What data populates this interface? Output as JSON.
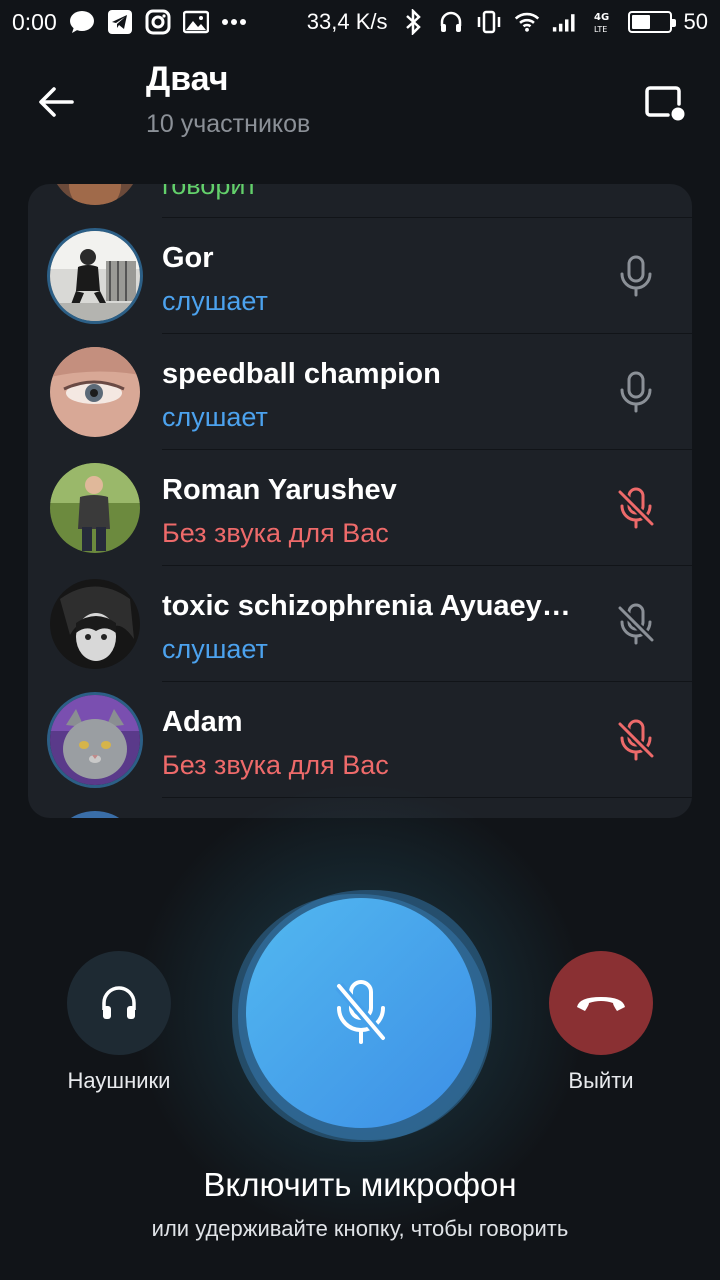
{
  "status_bar": {
    "time": "0:00",
    "speed": "33,4 K/s",
    "battery_level": "50",
    "battery_fraction": 0.5
  },
  "header": {
    "title": "Двач",
    "subtitle": "10 участников"
  },
  "participants": [
    {
      "name": "",
      "status": "говорит",
      "state": "speaking"
    },
    {
      "name": "Gor",
      "status": "слушает",
      "state": "listening"
    },
    {
      "name": "speedball champion",
      "status": "слушает",
      "state": "listening"
    },
    {
      "name": "Roman Yarushev",
      "status": "Без звука для Вас",
      "state": "muted_for_you"
    },
    {
      "name": "toxic schizophrenia Ayuaey…",
      "status": "слушает",
      "state": "muted"
    },
    {
      "name": "Adam",
      "status": "Без звука для Вас",
      "state": "muted_for_you"
    }
  ],
  "controls": {
    "headphones_label": "Наушники",
    "leave_label": "Выйти",
    "mic_title": "Включить микрофон",
    "mic_hint": "или удерживайте кнопку, чтобы говорить"
  },
  "colors": {
    "background": "#111418",
    "panel": "#1d2127",
    "listening": "#4ca2ee",
    "muted_for_you": "#ee6a6a",
    "speaking": "#63d16b",
    "leave_button": "#8a3033",
    "mic_button": "#47a3ee"
  },
  "icons": [
    "back-arrow-icon",
    "screen-share-icon",
    "microphone-icon",
    "microphone-off-icon",
    "headphones-icon",
    "end-call-icon"
  ]
}
